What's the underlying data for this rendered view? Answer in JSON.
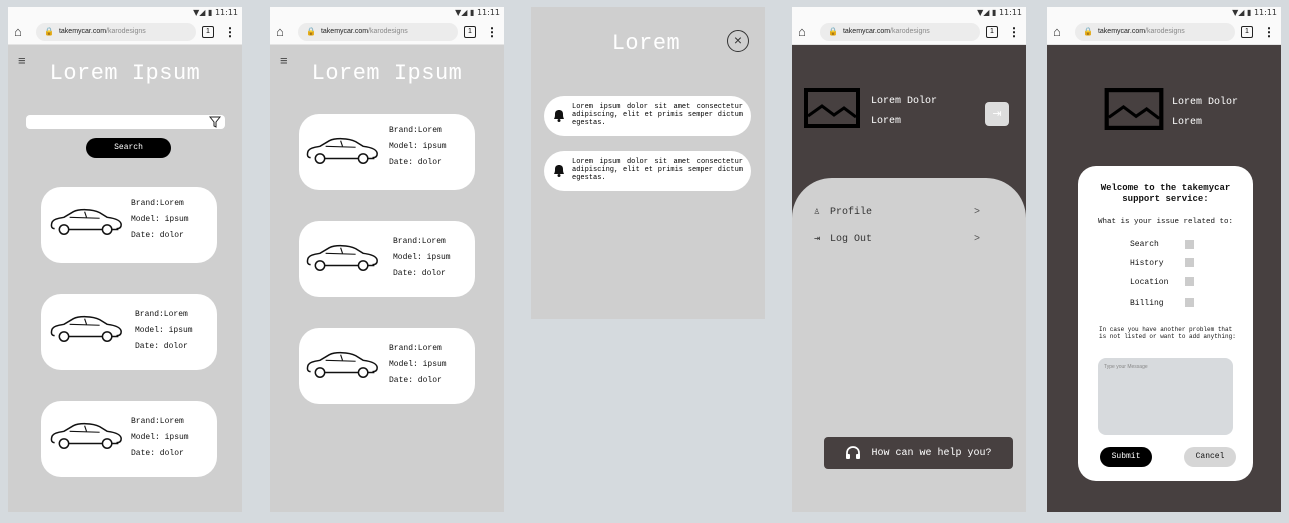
{
  "status": {
    "time": "11:11",
    "signal": "▼◢ ▮"
  },
  "browser": {
    "domain": "takemycar.com",
    "path": "/karodesigns",
    "tabs_count": "1"
  },
  "screens": {
    "list": {
      "title": "Lorem Ipsum",
      "search_label": "Search",
      "cards": [
        {
          "brand": "Brand:Lorem",
          "model": "Model: ipsum",
          "date": "Date: dolor"
        },
        {
          "brand": "Brand:Lorem",
          "model": "Model: ipsum",
          "date": "Date: dolor"
        },
        {
          "brand": "Brand:Lorem",
          "model": "Model: ipsum",
          "date": "Date: dolor"
        }
      ]
    },
    "list2": {
      "title": "Lorem Ipsum",
      "cards": [
        {
          "brand": "Brand:Lorem",
          "model": "Model: ipsum",
          "date": "Date: dolor"
        },
        {
          "brand": "Brand:Lorem",
          "model": "Model: ipsum",
          "date": "Date: dolor"
        },
        {
          "brand": "Brand:Lorem",
          "model": "Model: ipsum",
          "date": "Date: dolor"
        }
      ]
    },
    "notifications": {
      "title": "Lorem",
      "close_symbol": "×",
      "items": [
        {
          "text": "Lorem ipsum dolor sit amet consectetur adipiscing, elit et primis semper dictum egestas."
        },
        {
          "text": "Lorem ipsum dolor sit amet consectetur adipiscing, elit et primis semper dictum egestas."
        }
      ]
    },
    "menu": {
      "name": "Lorem Dolor",
      "sub": "Lorem",
      "items": [
        {
          "label": "Profile",
          "chevron": ">"
        },
        {
          "label": "Log Out",
          "chevron": ">"
        }
      ],
      "help": "How can we help you?"
    },
    "support": {
      "name": "Lorem Dolor",
      "sub": "Lorem",
      "welcome": "Welcome to the takemycar support service:",
      "question": "What is your issue related to:",
      "options": [
        "Search",
        "History",
        "Location",
        "Billing"
      ],
      "other": "In case you have another problem that is not listed or want to add anything:",
      "message_placeholder": "Type your Message",
      "submit": "Submit",
      "cancel": "Cancel"
    }
  },
  "colors": {
    "bg": "#d5dade",
    "screen_gray": "#cfcfcf",
    "dark": "#474040",
    "card": "#ffffff"
  }
}
